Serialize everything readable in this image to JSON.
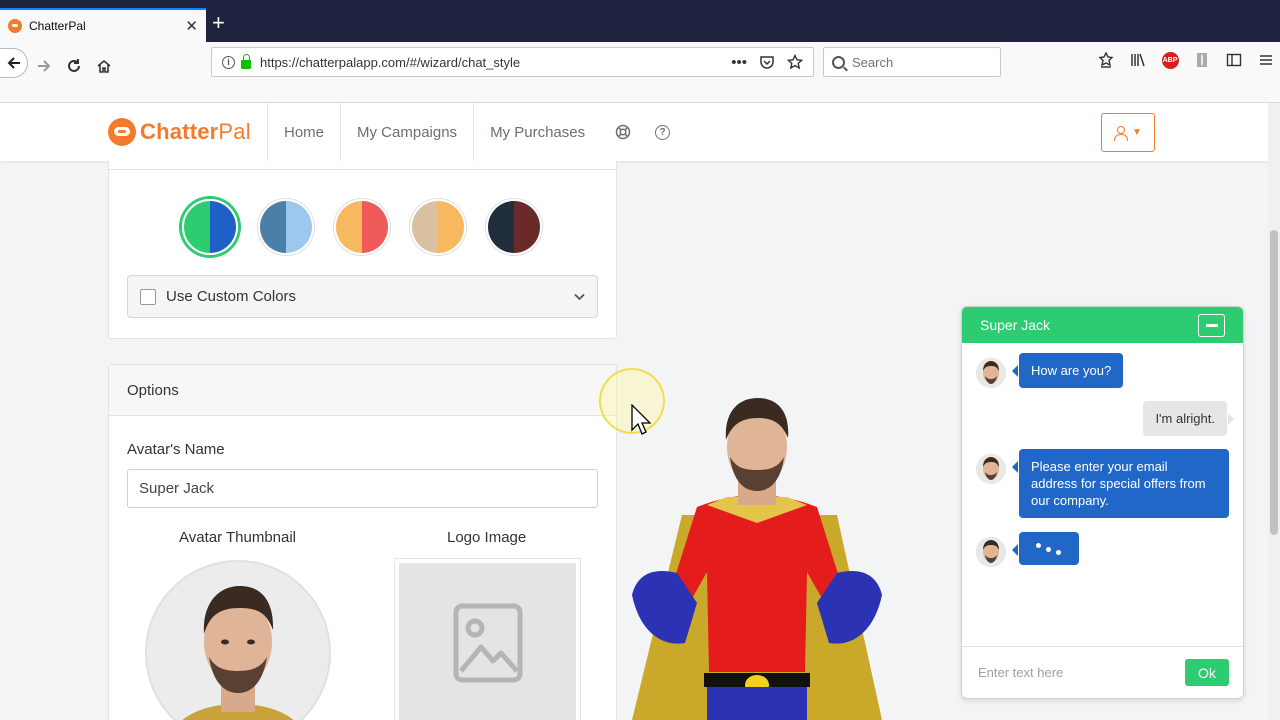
{
  "browser": {
    "tab_title": "ChatterPal",
    "url": "https://chatterpalapp.com/#/wizard/chat_style",
    "search_placeholder": "Search",
    "abp_label": "ABP"
  },
  "header": {
    "logo_brand_1": "Chatter",
    "logo_brand_2": "Pal",
    "nav": [
      {
        "label": "Home"
      },
      {
        "label": "My Campaigns"
      },
      {
        "label": "My Purchases"
      }
    ],
    "help_glyph": "?"
  },
  "colors": {
    "swatches": [
      {
        "left": "#2ecc71",
        "right": "#1e5fc8",
        "selected": true
      },
      {
        "left": "#4a7fa7",
        "right": "#9cc8ee",
        "selected": false
      },
      {
        "left": "#f8b860",
        "right": "#ef5a5a",
        "selected": false
      },
      {
        "left": "#d8c0a0",
        "right": "#f8b860",
        "selected": false
      },
      {
        "left": "#1f2d3d",
        "right": "#6a2a2a",
        "selected": false
      }
    ],
    "custom_colors_label": "Use Custom Colors"
  },
  "options": {
    "title": "Options",
    "avatar_name_label": "Avatar's Name",
    "avatar_name_value": "Super Jack",
    "thumbnail_label": "Avatar Thumbnail",
    "logo_label": "Logo Image"
  },
  "chat": {
    "title": "Super Jack",
    "messages": [
      {
        "from": "bot",
        "text": "How are you?"
      },
      {
        "from": "user",
        "text": "I'm alright."
      },
      {
        "from": "bot",
        "text": "Please enter your email address for special offers from our company."
      }
    ],
    "input_placeholder": "Enter text here",
    "ok_label": "Ok"
  },
  "theme": {
    "accent": "#f37b2b",
    "chat_green": "#2ecc71",
    "bubble_blue": "#2167c8"
  }
}
